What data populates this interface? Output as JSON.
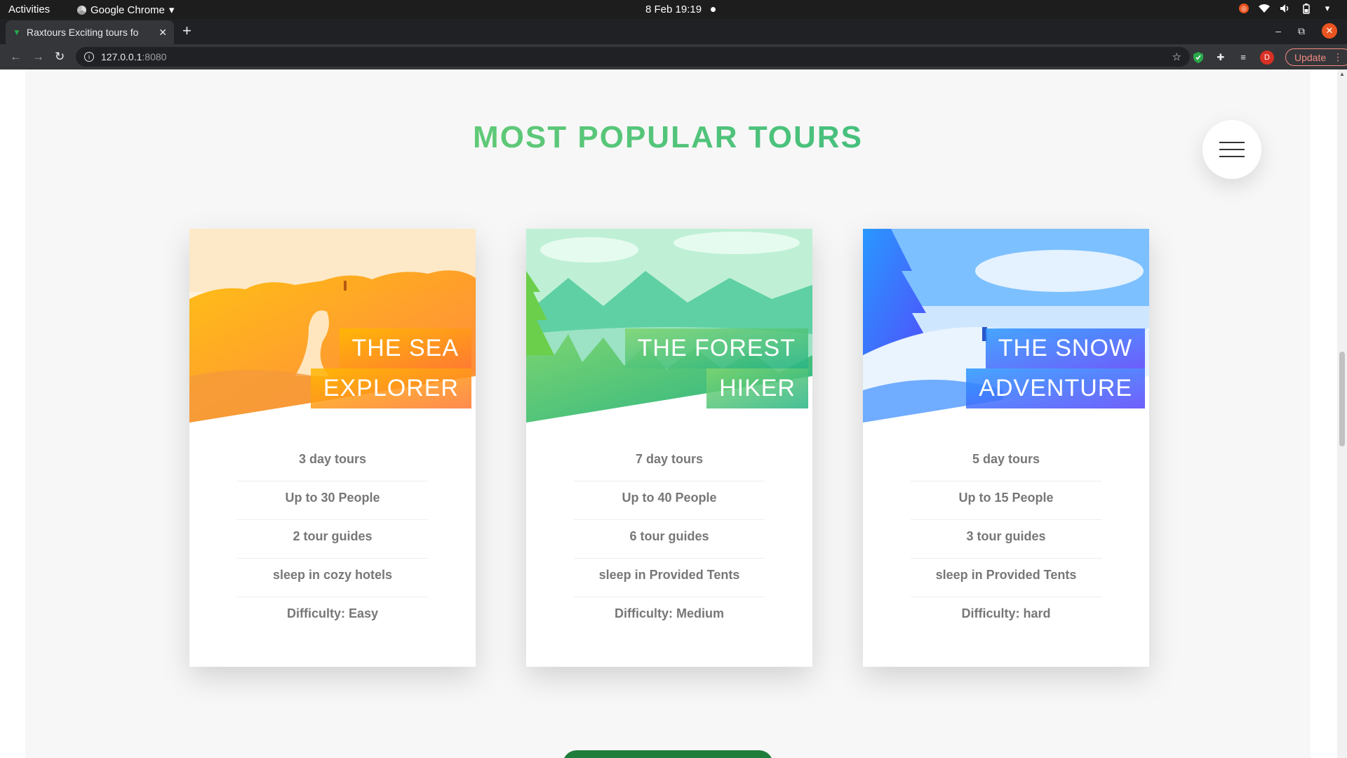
{
  "os_bar": {
    "activities": "Activities",
    "app_name": "Google Chrome",
    "clock": "8 Feb  19:19"
  },
  "browser": {
    "tab_title": "Raxtours Exciting tours fo",
    "url_host": "127.0.0.1",
    "url_port": ":8080",
    "update_label": "Update",
    "profile_initial": "D"
  },
  "section": {
    "heading": "MOST POPULAR TOURS"
  },
  "cards": [
    {
      "heading_line1": "THE SEA",
      "heading_line2": "EXPLORER",
      "details": [
        "3 day tours",
        "Up to 30 People",
        "2 tour guides",
        "sleep in cozy hotels",
        "Difficulty: Easy"
      ],
      "accent": "#ffb900",
      "accent2": "#ff7730"
    },
    {
      "heading_line1": "THE FOREST",
      "heading_line2": "HIKER",
      "details": [
        "7 day tours",
        "Up to 40 People",
        "6 tour guides",
        "sleep in Provided Tents",
        "Difficulty: Medium"
      ],
      "accent": "#7ed56f",
      "accent2": "#28b485"
    },
    {
      "heading_line1": "THE SNOW",
      "heading_line2": "ADVENTURE",
      "details": [
        "5 day tours",
        "Up to 15 People",
        "3 tour guides",
        "sleep in Provided Tents",
        "Difficulty: hard"
      ],
      "accent": "#2998ff",
      "accent2": "#5643fa"
    }
  ],
  "colors": {
    "heading_start": "#7ed56f",
    "heading_end": "#28b485",
    "cta": "#1e7d3a"
  }
}
